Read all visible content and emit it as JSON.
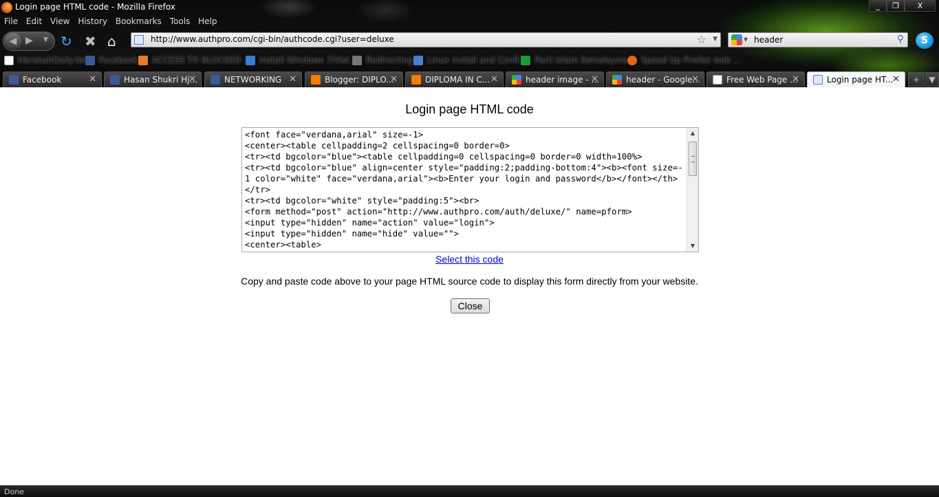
{
  "window": {
    "title": "Login page HTML code - Mozilla Firefox",
    "controls": [
      "_",
      "❐",
      "X"
    ]
  },
  "menu": [
    "File",
    "Edit",
    "View",
    "History",
    "Bookmarks",
    "Tools",
    "Help"
  ],
  "nav": {
    "url": "http://www.authpro.com/cgi-bin/authcode.cgi?user=deluxe",
    "search_query": "header"
  },
  "bookmarks": [
    {
      "label": "HarakahDaily.Net",
      "icon": "page-icon"
    },
    {
      "label": "Facebook",
      "icon": "facebook-icon"
    },
    {
      "label": "ACCESS TO BLOCKED ...",
      "icon": "rss-icon"
    },
    {
      "label": "Install Windows 7/Vist...",
      "icon": "windows-icon"
    },
    {
      "label": "Redirecting",
      "icon": "tools-icon"
    },
    {
      "label": "Linux Install and Confi...",
      "icon": "linux-icon"
    },
    {
      "label": "Parti Islam Semalaysia ...",
      "icon": "pas-icon"
    },
    {
      "label": "Speed Up Firefox web ...",
      "icon": "ubuntu-icon"
    }
  ],
  "tabs": [
    {
      "label": "Facebook",
      "icon": "facebook-icon"
    },
    {
      "label": "Hasan Shukri Hj...",
      "icon": "facebook-icon"
    },
    {
      "label": "NETWORKING",
      "icon": "facebook-icon"
    },
    {
      "label": "Blogger: DIPLO...",
      "icon": "blogger-icon"
    },
    {
      "label": "DIPLOMA IN C...",
      "icon": "blogger-icon"
    },
    {
      "label": "header image - ...",
      "icon": "google-icon"
    },
    {
      "label": "header - Google...",
      "icon": "google-icon"
    },
    {
      "label": "Free Web Page ...",
      "icon": "page-icon"
    },
    {
      "label": "Login page HT...",
      "icon": "site-icon",
      "active": true
    }
  ],
  "page": {
    "title": "Login page HTML code",
    "code": "<font face=\"verdana,arial\" size=-1>\n<center><table cellpadding=2 cellspacing=0 border=0>\n<tr><td bgcolor=\"blue\"><table cellpadding=0 cellspacing=0 border=0 width=100%>\n<tr><td bgcolor=\"blue\" align=center style=\"padding:2;padding-bottom:4\"><b><font size=-1 color=\"white\" face=\"verdana,arial\"><b>Enter your login and password</b></font></th></tr>\n<tr><td bgcolor=\"white\" style=\"padding:5\"><br>\n<form method=\"post\" action=\"http://www.authpro.com/auth/deluxe/\" name=pform>\n<input type=\"hidden\" name=\"action\" value=\"login\">\n<input type=\"hidden\" name=\"hide\" value=\"\">\n<center><table>",
    "select_link": "Select this code",
    "instructions": "Copy and paste code above to your page HTML source code to display this form directly from your website.",
    "close_label": "Close"
  },
  "status": "Done",
  "colors": {
    "facebook": "#3b5998",
    "blogger": "#f57d00",
    "link": "#0000cc"
  }
}
